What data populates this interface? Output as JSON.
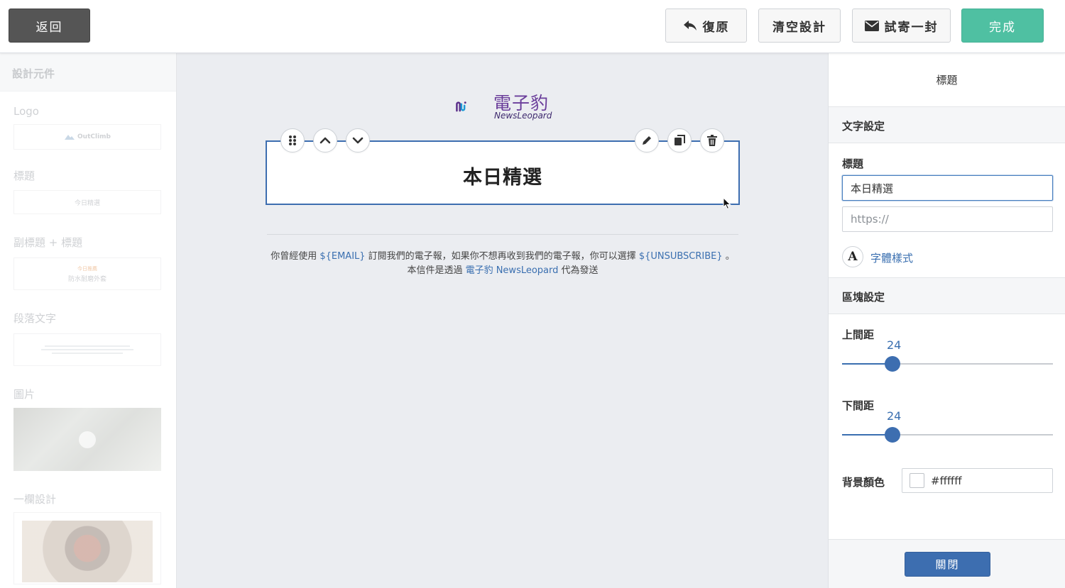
{
  "toolbar": {
    "back_label": "返回",
    "undo_label": "復原",
    "clear_label": "清空設計",
    "test_send_label": "試寄一封",
    "done_label": "完成"
  },
  "sidebar": {
    "heading": "設計元件",
    "items": [
      {
        "label": "Logo",
        "preview": "OutClimb"
      },
      {
        "label": "標題",
        "preview": "今日精選"
      },
      {
        "label": "副標題 + 標題",
        "preview_sub": "今日推薦",
        "preview": "防水耐磨外套"
      },
      {
        "label": "段落文字"
      },
      {
        "label": "圖片"
      },
      {
        "label": "一欄設計"
      }
    ]
  },
  "canvas": {
    "logo_zh": "電子豹",
    "logo_en": "NewsLeopard",
    "block_title": "本日精選",
    "footer": {
      "line1_a": "你曾經使用 ",
      "line1_email": "${EMAIL}",
      "line1_b": " 訂閱我們的電子報，如果你不想再收到我們的電子報，你可以選擇 ",
      "line1_unsub": "${UNSUBSCRIBE}",
      "line1_c": " 。",
      "line2_a": "本信件是透過 ",
      "line2_link": "電子豹 NewsLeopard",
      "line2_b": " 代為發送"
    }
  },
  "panel": {
    "title": "標題",
    "text_settings": "文字設定",
    "title_label": "標題",
    "title_value": "本日精選",
    "url_placeholder": "https://",
    "font_icon_letter": "A",
    "font_style_link": "字體樣式",
    "block_settings": "區塊設定",
    "top_padding_label": "上間距",
    "top_padding_value": 24,
    "top_padding_display": "24",
    "bottom_padding_label": "下間距",
    "bottom_padding_value": 24,
    "bottom_padding_display": "24",
    "slider_max": 100,
    "bg_color_label": "背景顏色",
    "bg_color_value": "#ffffff",
    "close_label": "關閉"
  },
  "colors": {
    "accent": "#3d6eb0",
    "done_green": "#4fc0a2",
    "back_dark": "#555555"
  }
}
